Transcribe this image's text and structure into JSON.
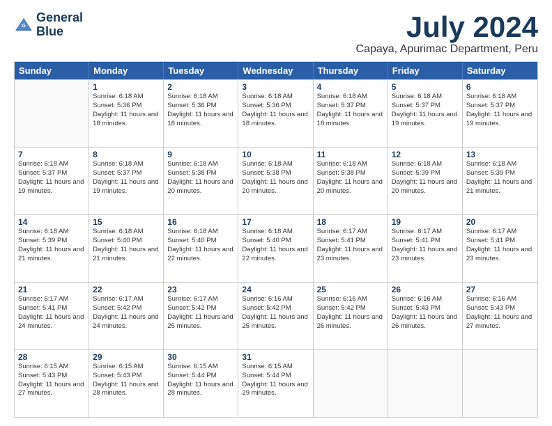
{
  "logo": {
    "line1": "General",
    "line2": "Blue"
  },
  "title": "July 2024",
  "subtitle": "Capaya, Apurimac Department, Peru",
  "header_days": [
    "Sunday",
    "Monday",
    "Tuesday",
    "Wednesday",
    "Thursday",
    "Friday",
    "Saturday"
  ],
  "weeks": [
    [
      {
        "day": "",
        "sunrise": "",
        "sunset": "",
        "daylight": ""
      },
      {
        "day": "1",
        "sunrise": "Sunrise: 6:18 AM",
        "sunset": "Sunset: 5:36 PM",
        "daylight": "Daylight: 11 hours and 18 minutes."
      },
      {
        "day": "2",
        "sunrise": "Sunrise: 6:18 AM",
        "sunset": "Sunset: 5:36 PM",
        "daylight": "Daylight: 11 hours and 18 minutes."
      },
      {
        "day": "3",
        "sunrise": "Sunrise: 6:18 AM",
        "sunset": "Sunset: 5:36 PM",
        "daylight": "Daylight: 11 hours and 18 minutes."
      },
      {
        "day": "4",
        "sunrise": "Sunrise: 6:18 AM",
        "sunset": "Sunset: 5:37 PM",
        "daylight": "Daylight: 11 hours and 18 minutes."
      },
      {
        "day": "5",
        "sunrise": "Sunrise: 6:18 AM",
        "sunset": "Sunset: 5:37 PM",
        "daylight": "Daylight: 11 hours and 19 minutes."
      },
      {
        "day": "6",
        "sunrise": "Sunrise: 6:18 AM",
        "sunset": "Sunset: 5:37 PM",
        "daylight": "Daylight: 11 hours and 19 minutes."
      }
    ],
    [
      {
        "day": "7",
        "sunrise": "Sunrise: 6:18 AM",
        "sunset": "Sunset: 5:37 PM",
        "daylight": "Daylight: 11 hours and 19 minutes."
      },
      {
        "day": "8",
        "sunrise": "Sunrise: 6:18 AM",
        "sunset": "Sunset: 5:37 PM",
        "daylight": "Daylight: 11 hours and 19 minutes."
      },
      {
        "day": "9",
        "sunrise": "Sunrise: 6:18 AM",
        "sunset": "Sunset: 5:38 PM",
        "daylight": "Daylight: 11 hours and 20 minutes."
      },
      {
        "day": "10",
        "sunrise": "Sunrise: 6:18 AM",
        "sunset": "Sunset: 5:38 PM",
        "daylight": "Daylight: 11 hours and 20 minutes."
      },
      {
        "day": "11",
        "sunrise": "Sunrise: 6:18 AM",
        "sunset": "Sunset: 5:38 PM",
        "daylight": "Daylight: 11 hours and 20 minutes."
      },
      {
        "day": "12",
        "sunrise": "Sunrise: 6:18 AM",
        "sunset": "Sunset: 5:39 PM",
        "daylight": "Daylight: 11 hours and 20 minutes."
      },
      {
        "day": "13",
        "sunrise": "Sunrise: 6:18 AM",
        "sunset": "Sunset: 5:39 PM",
        "daylight": "Daylight: 11 hours and 21 minutes."
      }
    ],
    [
      {
        "day": "14",
        "sunrise": "Sunrise: 6:18 AM",
        "sunset": "Sunset: 5:39 PM",
        "daylight": "Daylight: 11 hours and 21 minutes."
      },
      {
        "day": "15",
        "sunrise": "Sunrise: 6:18 AM",
        "sunset": "Sunset: 5:40 PM",
        "daylight": "Daylight: 11 hours and 21 minutes."
      },
      {
        "day": "16",
        "sunrise": "Sunrise: 6:18 AM",
        "sunset": "Sunset: 5:40 PM",
        "daylight": "Daylight: 11 hours and 22 minutes."
      },
      {
        "day": "17",
        "sunrise": "Sunrise: 6:18 AM",
        "sunset": "Sunset: 5:40 PM",
        "daylight": "Daylight: 11 hours and 22 minutes."
      },
      {
        "day": "18",
        "sunrise": "Sunrise: 6:17 AM",
        "sunset": "Sunset: 5:41 PM",
        "daylight": "Daylight: 11 hours and 23 minutes."
      },
      {
        "day": "19",
        "sunrise": "Sunrise: 6:17 AM",
        "sunset": "Sunset: 5:41 PM",
        "daylight": "Daylight: 11 hours and 23 minutes."
      },
      {
        "day": "20",
        "sunrise": "Sunrise: 6:17 AM",
        "sunset": "Sunset: 5:41 PM",
        "daylight": "Daylight: 11 hours and 23 minutes."
      }
    ],
    [
      {
        "day": "21",
        "sunrise": "Sunrise: 6:17 AM",
        "sunset": "Sunset: 5:41 PM",
        "daylight": "Daylight: 11 hours and 24 minutes."
      },
      {
        "day": "22",
        "sunrise": "Sunrise: 6:17 AM",
        "sunset": "Sunset: 5:42 PM",
        "daylight": "Daylight: 11 hours and 24 minutes."
      },
      {
        "day": "23",
        "sunrise": "Sunrise: 6:17 AM",
        "sunset": "Sunset: 5:42 PM",
        "daylight": "Daylight: 11 hours and 25 minutes."
      },
      {
        "day": "24",
        "sunrise": "Sunrise: 6:16 AM",
        "sunset": "Sunset: 5:42 PM",
        "daylight": "Daylight: 11 hours and 25 minutes."
      },
      {
        "day": "25",
        "sunrise": "Sunrise: 6:16 AM",
        "sunset": "Sunset: 5:42 PM",
        "daylight": "Daylight: 11 hours and 26 minutes."
      },
      {
        "day": "26",
        "sunrise": "Sunrise: 6:16 AM",
        "sunset": "Sunset: 5:43 PM",
        "daylight": "Daylight: 11 hours and 26 minutes."
      },
      {
        "day": "27",
        "sunrise": "Sunrise: 6:16 AM",
        "sunset": "Sunset: 5:43 PM",
        "daylight": "Daylight: 11 hours and 27 minutes."
      }
    ],
    [
      {
        "day": "28",
        "sunrise": "Sunrise: 6:15 AM",
        "sunset": "Sunset: 5:43 PM",
        "daylight": "Daylight: 11 hours and 27 minutes."
      },
      {
        "day": "29",
        "sunrise": "Sunrise: 6:15 AM",
        "sunset": "Sunset: 5:43 PM",
        "daylight": "Daylight: 11 hours and 28 minutes."
      },
      {
        "day": "30",
        "sunrise": "Sunrise: 6:15 AM",
        "sunset": "Sunset: 5:44 PM",
        "daylight": "Daylight: 11 hours and 28 minutes."
      },
      {
        "day": "31",
        "sunrise": "Sunrise: 6:15 AM",
        "sunset": "Sunset: 5:44 PM",
        "daylight": "Daylight: 11 hours and 29 minutes."
      },
      {
        "day": "",
        "sunrise": "",
        "sunset": "",
        "daylight": ""
      },
      {
        "day": "",
        "sunrise": "",
        "sunset": "",
        "daylight": ""
      },
      {
        "day": "",
        "sunrise": "",
        "sunset": "",
        "daylight": ""
      }
    ]
  ]
}
